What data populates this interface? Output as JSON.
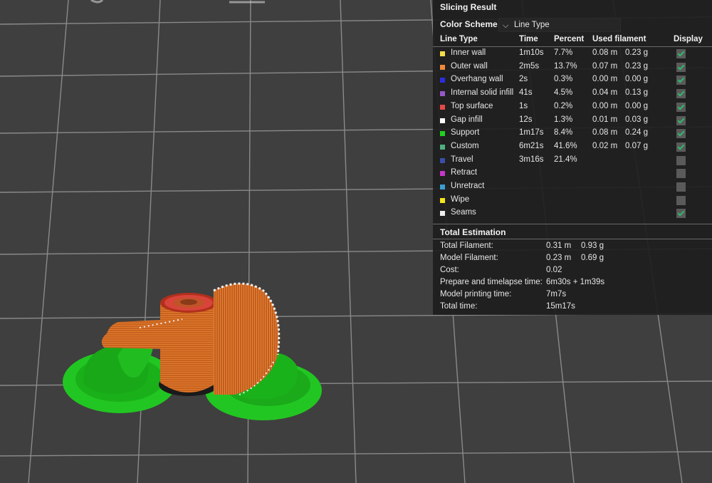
{
  "panel": {
    "title": "Slicing Result",
    "color_scheme_label": "Color Scheme",
    "color_scheme_value": "Line Type",
    "columns": {
      "line_type": "Line Type",
      "time": "Time",
      "percent": "Percent",
      "used_filament": "Used filament",
      "display": "Display"
    },
    "rows": [
      {
        "name": "Inner wall",
        "color": "#f5dc4c",
        "time": "1m10s",
        "percent": "7.7%",
        "length": "0.08 m",
        "weight": "0.23 g",
        "display": true
      },
      {
        "name": "Outer wall",
        "color": "#f08a3c",
        "time": "2m5s",
        "percent": "13.7%",
        "length": "0.07 m",
        "weight": "0.23 g",
        "display": true
      },
      {
        "name": "Overhang wall",
        "color": "#2b2ee0",
        "time": "2s",
        "percent": "0.3%",
        "length": "0.00 m",
        "weight": "0.00 g",
        "display": true
      },
      {
        "name": "Internal solid infill",
        "color": "#9658c8",
        "time": "41s",
        "percent": "4.5%",
        "length": "0.04 m",
        "weight": "0.13 g",
        "display": true
      },
      {
        "name": "Top surface",
        "color": "#e64848",
        "time": "1s",
        "percent": "0.2%",
        "length": "0.00 m",
        "weight": "0.00 g",
        "display": true
      },
      {
        "name": "Gap infill",
        "color": "#ffffff",
        "time": "12s",
        "percent": "1.3%",
        "length": "0.01 m",
        "weight": "0.03 g",
        "display": true
      },
      {
        "name": "Support",
        "color": "#1ed41e",
        "time": "1m17s",
        "percent": "8.4%",
        "length": "0.08 m",
        "weight": "0.24 g",
        "display": true
      },
      {
        "name": "Custom",
        "color": "#4fb07e",
        "time": "6m21s",
        "percent": "41.6%",
        "length": "0.02 m",
        "weight": "0.07 g",
        "display": true
      },
      {
        "name": "Travel",
        "color": "#3a4ea8",
        "time": "3m16s",
        "percent": "21.4%",
        "length": "",
        "weight": "",
        "display": false
      },
      {
        "name": "Retract",
        "color": "#c837c8",
        "time": "",
        "percent": "",
        "length": "",
        "weight": "",
        "display": false
      },
      {
        "name": "Unretract",
        "color": "#3a9ed0",
        "time": "",
        "percent": "",
        "length": "",
        "weight": "",
        "display": false
      },
      {
        "name": "Wipe",
        "color": "#f5e61c",
        "time": "",
        "percent": "",
        "length": "",
        "weight": "",
        "display": false
      },
      {
        "name": "Seams",
        "color": "#eeeeee",
        "time": "",
        "percent": "",
        "length": "",
        "weight": "",
        "display": true
      }
    ],
    "total_title": "Total Estimation",
    "totals": [
      {
        "label": "Total Filament:",
        "v1": "0.31 m",
        "v2": "0.93 g"
      },
      {
        "label": "Model Filament:",
        "v1": "0.23 m",
        "v2": "0.69 g"
      },
      {
        "label": "Cost:",
        "v1": "0.02",
        "v2": ""
      },
      {
        "label": "Prepare and timelapse time:",
        "v1": "6m30s + 1m39s",
        "v2": ""
      },
      {
        "label": "Model printing time:",
        "v1": "7m7s",
        "v2": ""
      },
      {
        "label": "Total time:",
        "v1": "15m17s",
        "v2": ""
      }
    ]
  }
}
